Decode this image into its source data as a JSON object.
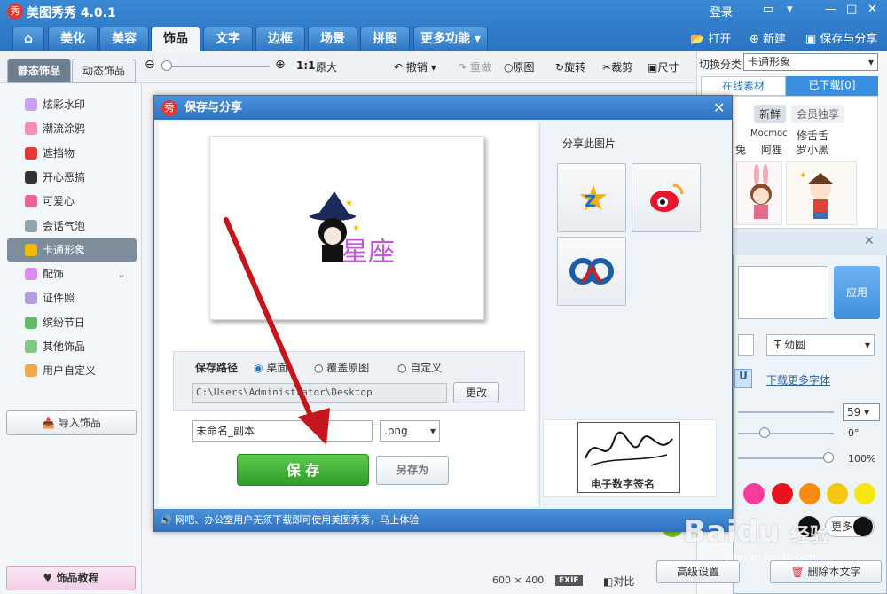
{
  "app": {
    "title": "美图秀秀 4.0.1",
    "logo_char": "秀",
    "login": "登录"
  },
  "tabs": [
    "饰品",
    "文字",
    "边框",
    "场景",
    "拼图"
  ],
  "tabs_left": [
    "美化",
    "美容"
  ],
  "more_tab": "更多功能",
  "top_actions": {
    "open": "打开",
    "new": "新建",
    "save_share": "保存与分享"
  },
  "toolbar": {
    "ratio": "1:1",
    "original_size": "原大",
    "undo": "撤销",
    "redo": "重做",
    "original": "原图",
    "rotate": "旋转",
    "crop": "裁剪",
    "resize": "尺寸"
  },
  "sidebar": {
    "tab_static": "静态饰品",
    "tab_dynamic": "动态饰品",
    "items": [
      "炫彩水印",
      "潮流涂鸦",
      "遮挡物",
      "开心恶搞",
      "可爱心",
      "会话气泡",
      "卡通形象",
      "配饰",
      "证件照",
      "缤纷节日",
      "其他饰品",
      "用户自定义"
    ],
    "selected": "卡通形象",
    "import": "导入饰品",
    "tutorial": "饰品教程"
  },
  "right": {
    "switch_label": "切换分类",
    "category": "卡通形象",
    "tab_online": "在线素材",
    "tab_downloaded": "已下载[0]",
    "sub_new": "新鲜",
    "sub_vip": "会员独享",
    "names": [
      "Mocmoc",
      "修舌舌"
    ],
    "names2": [
      "兔",
      "阿狸",
      "罗小黑"
    ],
    "apply": "应用",
    "font": "幼圆",
    "more_fonts": "下载更多字体",
    "font_size": "59",
    "angle": "0°",
    "opacity": "100%",
    "more": "更多",
    "advanced": "高级设置",
    "delete_text": "删除本文字",
    "u_label": "U"
  },
  "dialog": {
    "title": "保存与分享",
    "preview_text": "星座",
    "save_path_label": "保存路径",
    "opt_desktop": "桌面",
    "opt_overwrite": "覆盖原图",
    "opt_custom": "自定义",
    "path": "C:\\Users\\Administrator\\Desktop",
    "change": "更改",
    "filename": "未命名_副本",
    "format": ".png",
    "save": "保 存",
    "save_as": "另存为",
    "share_title": "分享此图片",
    "signature_caption": "电子数字签名",
    "footer": "网吧、办公室用户无须下载即可使用美图秀秀，马上体验"
  },
  "status": {
    "size_w": "600",
    "size_x": "×",
    "size_h": "400",
    "exif": "EXIF",
    "compare": "对比"
  },
  "colors": {
    "accent": "#2e78c6",
    "save_green": "#3aac32",
    "arrow": "#c4161c"
  },
  "watermark": {
    "brand": "Baidu",
    "brand2": "经验",
    "url": "jingyan.baidu.com"
  }
}
